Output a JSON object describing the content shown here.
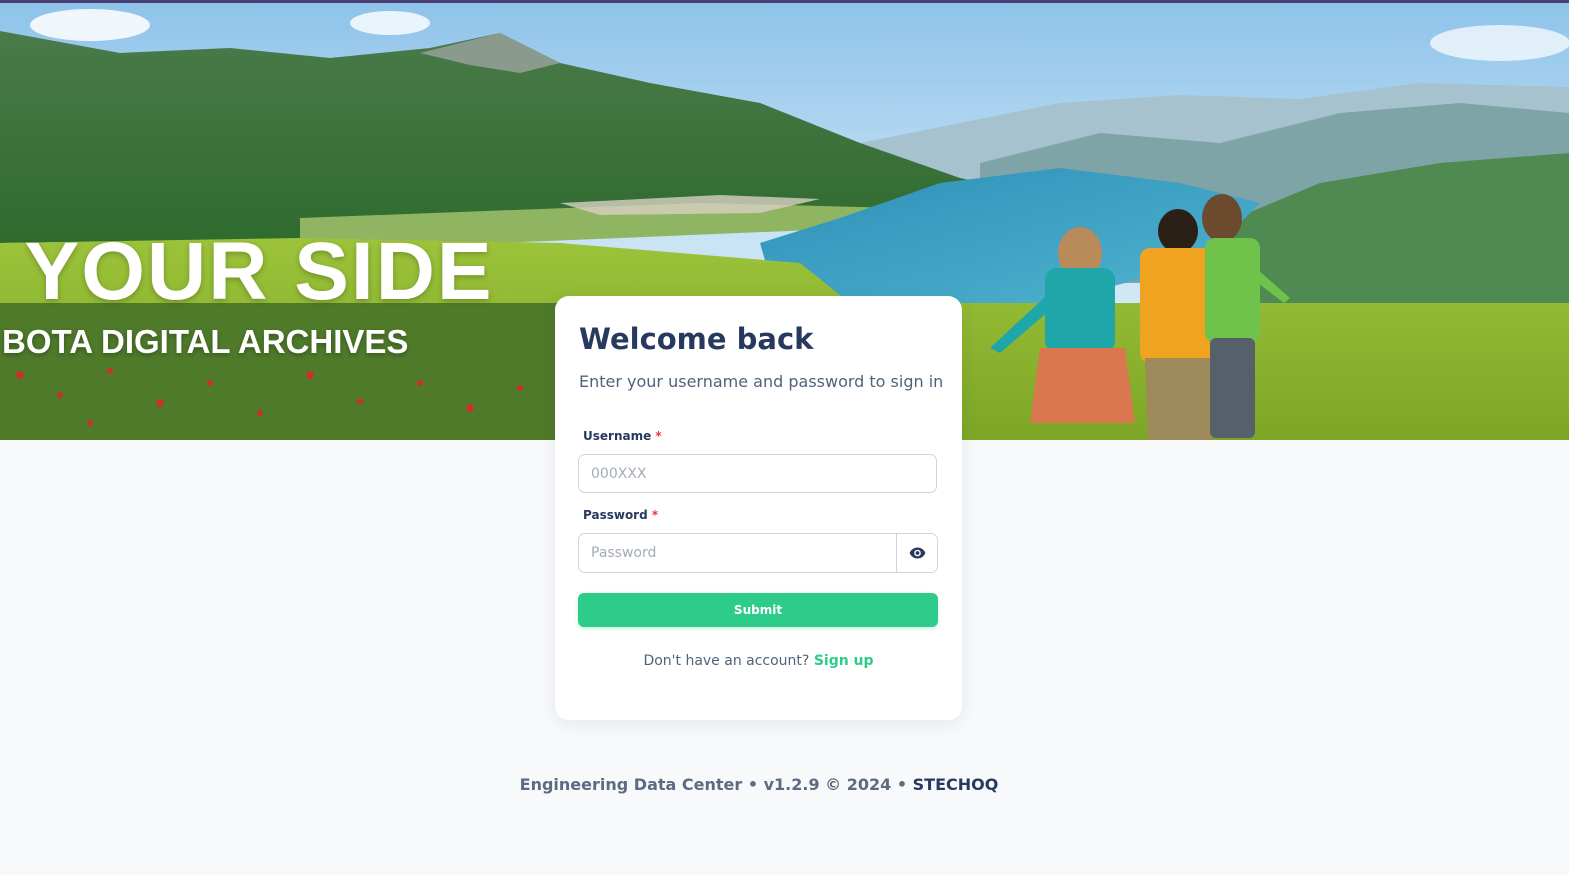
{
  "hero": {
    "title": "N YOUR SIDE",
    "subtitle": "BOTA DIGITAL ARCHIVES"
  },
  "login": {
    "title": "Welcome back",
    "subtitle": "Enter your username and password to sign in",
    "username_label": "Username",
    "username_placeholder": "000XXX",
    "password_label": "Password",
    "password_placeholder": "Password",
    "required_mark": "*",
    "submit_label": "Submit",
    "signup_prompt": "Don't have an account?",
    "signup_link": "Sign up",
    "password_toggle_icon": "eye-icon"
  },
  "footer": {
    "text": "Engineering Data Center • v1.2.9 © 2024 •",
    "brand": "STECHOQ"
  },
  "colors": {
    "accent": "#2ecc8b",
    "heading": "#27395f",
    "required": "#e8344e",
    "topbar": "#4b3f73",
    "background": "#f7f9fb"
  }
}
